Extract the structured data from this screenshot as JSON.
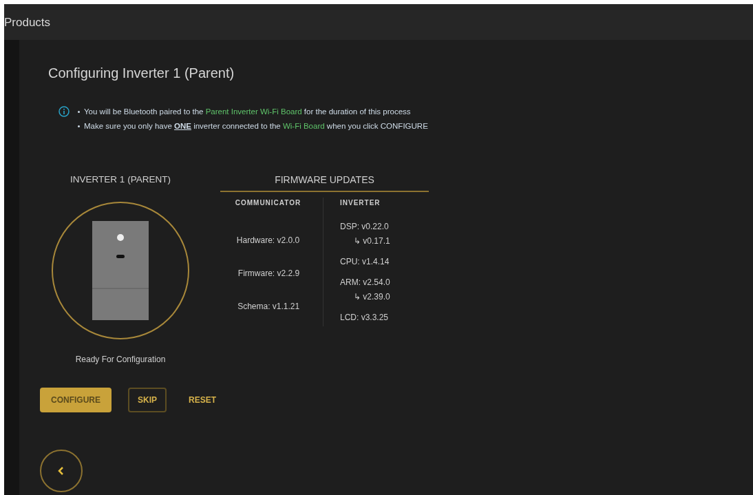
{
  "header": {
    "title": "Products"
  },
  "page_title": "Configuring Inverter 1 (Parent)",
  "notice": [
    {
      "parts": [
        {
          "kind": "plain",
          "text": "You will be Bluetooth paired to the "
        },
        {
          "kind": "highlight",
          "text": "Parent Inverter Wi-Fi Board"
        },
        {
          "kind": "plain",
          "text": " for the duration of this process"
        }
      ]
    },
    {
      "parts": [
        {
          "kind": "plain",
          "text": "Make sure you only have "
        },
        {
          "kind": "emphasis",
          "text": "ONE"
        },
        {
          "kind": "plain",
          "text": " inverter connected to the "
        },
        {
          "kind": "highlight",
          "text": "Wi-Fi Board"
        },
        {
          "kind": "plain",
          "text": " when you click CONFIGURE"
        }
      ]
    }
  ],
  "device": {
    "title": "INVERTER 1 (PARENT)",
    "status": "Ready For Configuration"
  },
  "firmware": {
    "title": "FIRMWARE UPDATES",
    "communicator": {
      "heading": "COMMUNICATOR",
      "items": [
        "Hardware: v2.0.0",
        "Firmware: v2.2.9",
        "Schema: v1.1.21"
      ]
    },
    "inverter": {
      "heading": "INVERTER",
      "items": [
        {
          "text": "DSP: v0.22.0",
          "sub": "↳ v0.17.1"
        },
        {
          "text": "CPU: v1.4.14"
        },
        {
          "text": "ARM: v2.54.0",
          "sub": "↳ v2.39.0"
        },
        {
          "text": "LCD: v3.3.25"
        }
      ]
    }
  },
  "buttons": [
    {
      "kind": "primary",
      "label": "CONFIGURE"
    },
    {
      "kind": "outline",
      "label": "SKIP"
    },
    {
      "kind": "text",
      "label": "RESET"
    }
  ]
}
